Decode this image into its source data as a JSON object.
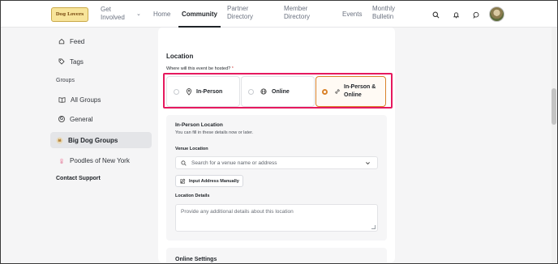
{
  "header": {
    "logo_text": "Dog Lovers",
    "nav": [
      {
        "label": "Get\nInvolved"
      },
      {
        "label": "Home"
      },
      {
        "label": "Community"
      },
      {
        "label": "Partner\nDirectory"
      },
      {
        "label": "Member\nDirectory"
      },
      {
        "label": "Events"
      },
      {
        "label": "Monthly\nBulletin"
      }
    ],
    "active_tab": "Community"
  },
  "sidebar": {
    "feed": "Feed",
    "tags": "Tags",
    "groups_heading": "Groups",
    "all_groups": "All Groups",
    "general": "General",
    "general_badge": "G",
    "big_dog_groups": "Big Dog Groups",
    "poodles": "Poodles of New York",
    "contact_support": "Contact Support"
  },
  "location": {
    "title": "Location",
    "question": "Where will this event be hosted?",
    "required_mark": "*",
    "options": [
      {
        "label": "In-Person",
        "selected": false
      },
      {
        "label": "Online",
        "selected": false
      },
      {
        "label": "In-Person &\nOnline",
        "selected": true
      }
    ],
    "in_person": {
      "title": "In-Person Location",
      "hint": "You can fill in these details now or later.",
      "venue_label": "Venue Location",
      "venue_placeholder": "Search for a venue name or address",
      "manual_button": "Input Address Manually",
      "details_label": "Location Details",
      "details_placeholder": "Provide any additional details about this location"
    },
    "online_settings_title": "Online Settings"
  },
  "colors": {
    "accent": "#d9822b",
    "highlight": "#e6195e"
  }
}
